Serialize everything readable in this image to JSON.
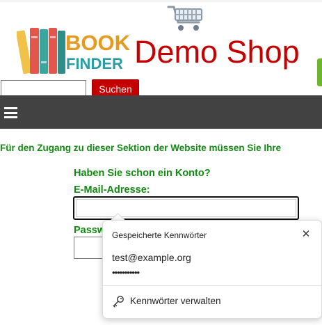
{
  "header": {
    "logo_top": "BOOK",
    "logo_bottom": "FINDER",
    "shop_title": "Demo Shop"
  },
  "search": {
    "value": "",
    "button_label": "Suchen"
  },
  "icons": {
    "cart": "shopping-cart-icon",
    "menu": "hamburger-menu-icon",
    "close": "close-icon",
    "key": "key-icon"
  },
  "colors": {
    "brand_red": "#c40000",
    "nav_bg": "#424242",
    "text_green": "#138a13",
    "accent_green": "#6cb52d"
  },
  "content": {
    "notice": "Für den Zugang zu dieser Sektion der Website müssen Sie Ihre",
    "have_account": "Haben Sie schon ein Konto?",
    "email_label": "E-Mail-Adresse:",
    "email_value": "",
    "password_label": "Passw"
  },
  "password_popup": {
    "title": "Gespeicherte Kennwörter",
    "entries": [
      {
        "username": "test@example.org",
        "password_mask": "•••••••••••"
      }
    ],
    "manage_label": "Kennwörter verwalten"
  }
}
